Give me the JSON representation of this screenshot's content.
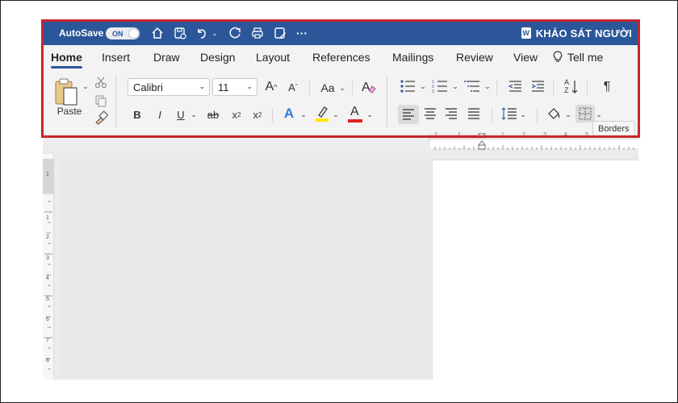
{
  "titlebar": {
    "autosave_label": "AutoSave",
    "toggle_state": "ON",
    "doc_title": "KHẢO SÁT NGƯỜI",
    "accent": "#2b579a"
  },
  "tabs": [
    {
      "label": "Home",
      "active": true
    },
    {
      "label": "Insert"
    },
    {
      "label": "Draw"
    },
    {
      "label": "Design"
    },
    {
      "label": "Layout"
    },
    {
      "label": "References"
    },
    {
      "label": "Mailings"
    },
    {
      "label": "Review"
    },
    {
      "label": "View"
    },
    {
      "label": "Tell me"
    }
  ],
  "ribbon": {
    "paste_label": "Paste",
    "font_name": "Calibri",
    "font_size": "11",
    "bold": "B",
    "italic": "I",
    "underline": "U",
    "strikethrough": "ab",
    "subscript": "x",
    "subscript_mark": "2",
    "superscript": "x",
    "superscript_mark": "2",
    "grow": "A",
    "shrink": "A",
    "case": "Aa",
    "text_effects": "A",
    "font_color": "A",
    "pilcrow": "¶",
    "sort_az": "A",
    "sort_z": "Z"
  },
  "tooltip": "Borders",
  "vruler_numbers": [
    "1",
    "1",
    "2",
    "3",
    "4",
    "5",
    "6",
    "7",
    "8"
  ],
  "hruler_numbers": [
    "2",
    "1",
    "1",
    "2",
    "3",
    "4",
    "5"
  ],
  "colors": {
    "highlight_box": "#c8262d",
    "highlight_color": "#ffe600",
    "font_color": "#e02020"
  }
}
